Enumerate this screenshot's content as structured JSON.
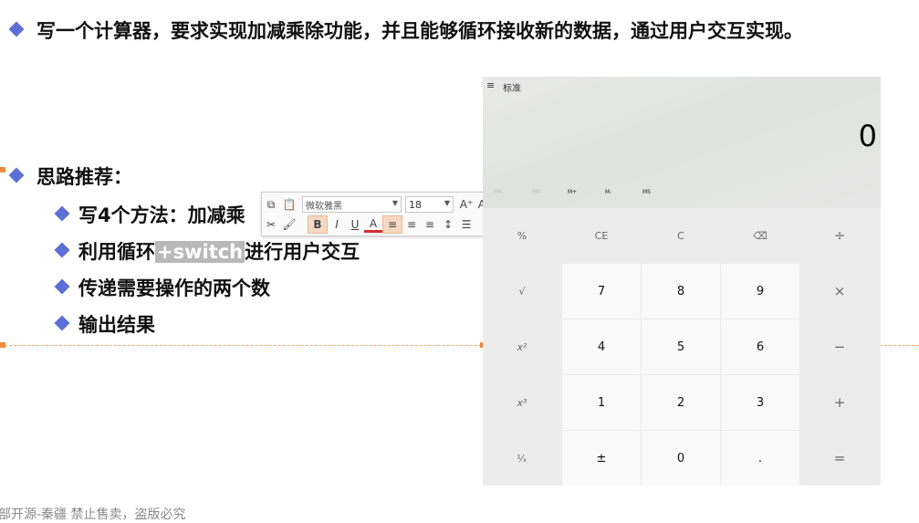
{
  "slide": {
    "title": "写一个计算器，要求实现加减乘除功能，并且能够循环接收新的数据，通过用户交互实现。",
    "heading": "思路推荐：",
    "bullets": [
      {
        "text": "写4个方法：加减乘"
      },
      {
        "pre": "利用循环",
        "highlight": "+switch",
        "post": "进行用户交互"
      },
      {
        "text": "传递需要操作的两个数"
      },
      {
        "text": "输出结果"
      }
    ],
    "footer": "部开源-秦疆     禁止售卖，盗版必究"
  },
  "mini_toolbar": {
    "font_name": "微软雅黑",
    "font_size": "18",
    "grow_label": "A⁺",
    "shrink_label": "A⁻",
    "bold_label": "B",
    "italic_label": "I",
    "underline_label": "U",
    "color_label": "A"
  },
  "calculator": {
    "menu_icon": "≡",
    "mode": "标准",
    "display": "0",
    "memory": [
      {
        "label": "MC",
        "enabled": false
      },
      {
        "label": "MR",
        "enabled": false
      },
      {
        "label": "M+",
        "enabled": true
      },
      {
        "label": "M-",
        "enabled": true
      },
      {
        "label": "MS",
        "enabled": true
      }
    ],
    "keys": [
      [
        "%",
        "CE",
        "C",
        "⌫",
        "÷"
      ],
      [
        "√",
        "7",
        "8",
        "9",
        "×"
      ],
      [
        "x²",
        "4",
        "5",
        "6",
        "−"
      ],
      [
        "x³",
        "1",
        "2",
        "3",
        "+"
      ],
      [
        "¹⁄ₓ",
        "±",
        "0",
        ".",
        "="
      ]
    ]
  }
}
